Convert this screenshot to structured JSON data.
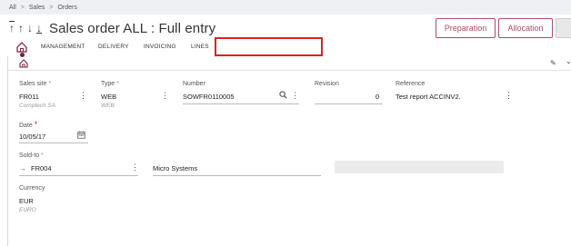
{
  "breadcrumb": {
    "items": [
      "All",
      "Sales",
      "Orders"
    ],
    "sep": ">"
  },
  "title": {
    "arrows": [
      "↑",
      "↑",
      "↓",
      "↓"
    ],
    "text": "Sales order ALL : Full entry"
  },
  "actions": {
    "preparation": "Preparation",
    "allocation": "Allocation"
  },
  "tabs": {
    "management": "MANAGEMENT",
    "delivery": "DELIVERY",
    "invoicing": "INVOICING",
    "lines": "LINES"
  },
  "form": {
    "sales_site": {
      "label": "Sales site",
      "value": "FR011",
      "sub": "Comptech SA"
    },
    "type": {
      "label": "Type",
      "value": "WEB",
      "sub": "WEB"
    },
    "number": {
      "label": "Number",
      "value": "SOWFR0110005"
    },
    "revision": {
      "label": "Revision",
      "value": "0"
    },
    "reference": {
      "label": "Reference",
      "value": "Test report ACCINV2."
    },
    "date": {
      "label": "Date",
      "value": "10/05/17"
    },
    "sold_to": {
      "label": "Sold-to",
      "value": "FR004",
      "name": "Micro Systems"
    },
    "currency": {
      "label": "Currency",
      "value": "EUR",
      "sub": "EURO"
    }
  },
  "icons": {
    "required": "*",
    "kebab": "⋮",
    "arrow_right": "→",
    "search": "search-icon",
    "calendar": "calendar-icon",
    "pencil": "✎",
    "chevron": "⌄"
  }
}
